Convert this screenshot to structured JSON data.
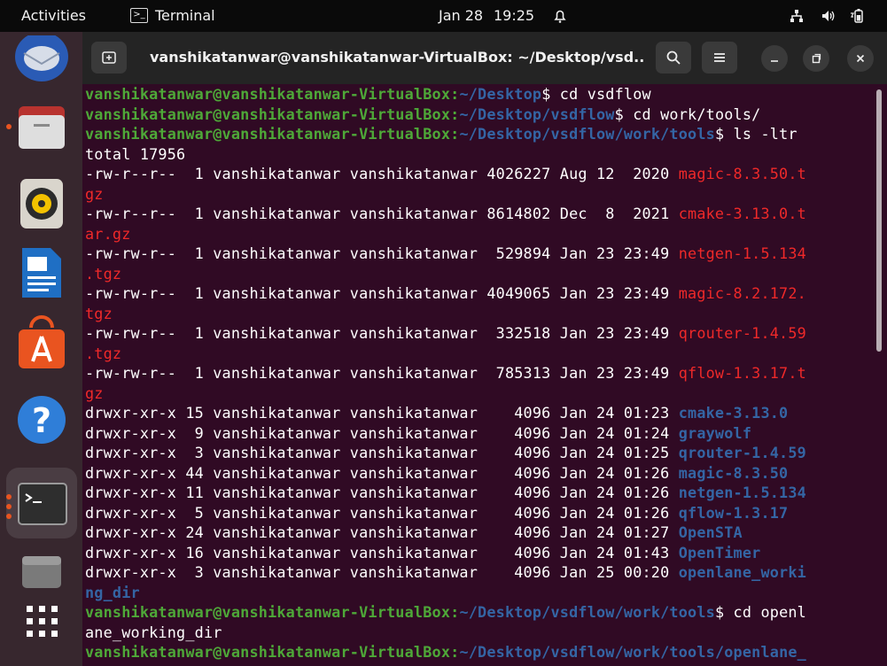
{
  "topbar": {
    "activities": "Activities",
    "app_name": "Terminal",
    "date": "Jan 28",
    "time": "19:25"
  },
  "window": {
    "title": "vanshikatanwar@vanshikatanwar-VirtualBox: ~/Desktop/vsd..."
  },
  "terminal": {
    "lines": [
      {
        "kind": "prompt",
        "user": "vanshikatanwar@vanshikatanwar-VirtualBox",
        "path": "~/Desktop",
        "cmd": "$ cd vsdflow"
      },
      {
        "kind": "prompt",
        "user": "vanshikatanwar@vanshikatanwar-VirtualBox",
        "path": "~/Desktop/vsdflow",
        "cmd": "$ cd work/tools/"
      },
      {
        "kind": "prompt",
        "user": "vanshikatanwar@vanshikatanwar-VirtualBox",
        "path": "~/Desktop/vsdflow/work/tools",
        "cmd": "$ ls -ltr"
      },
      {
        "kind": "text",
        "text": "total 17956"
      },
      {
        "kind": "entry",
        "meta": "-rw-r--r--  1 vanshikatanwar vanshikatanwar 4026227 Aug 12  2020 ",
        "name": "magic-8.3.50.t",
        "type": "arc"
      },
      {
        "kind": "cont",
        "name": "gz",
        "type": "arc"
      },
      {
        "kind": "entry",
        "meta": "-rw-r--r--  1 vanshikatanwar vanshikatanwar 8614802 Dec  8  2021 ",
        "name": "cmake-3.13.0.t",
        "type": "arc"
      },
      {
        "kind": "cont",
        "name": "ar.gz",
        "type": "arc"
      },
      {
        "kind": "entry",
        "meta": "-rw-rw-r--  1 vanshikatanwar vanshikatanwar  529894 Jan 23 23:49 ",
        "name": "netgen-1.5.134",
        "type": "arc"
      },
      {
        "kind": "cont",
        "name": ".tgz",
        "type": "arc"
      },
      {
        "kind": "entry",
        "meta": "-rw-rw-r--  1 vanshikatanwar vanshikatanwar 4049065 Jan 23 23:49 ",
        "name": "magic-8.2.172.",
        "type": "arc"
      },
      {
        "kind": "cont",
        "name": "tgz",
        "type": "arc"
      },
      {
        "kind": "entry",
        "meta": "-rw-rw-r--  1 vanshikatanwar vanshikatanwar  332518 Jan 23 23:49 ",
        "name": "qrouter-1.4.59",
        "type": "arc"
      },
      {
        "kind": "cont",
        "name": ".tgz",
        "type": "arc"
      },
      {
        "kind": "entry",
        "meta": "-rw-rw-r--  1 vanshikatanwar vanshikatanwar  785313 Jan 23 23:49 ",
        "name": "qflow-1.3.17.t",
        "type": "arc"
      },
      {
        "kind": "cont",
        "name": "gz",
        "type": "arc"
      },
      {
        "kind": "entry",
        "meta": "drwxr-xr-x 15 vanshikatanwar vanshikatanwar    4096 Jan 24 01:23 ",
        "name": "cmake-3.13.0",
        "type": "dir"
      },
      {
        "kind": "entry",
        "meta": "drwxr-xr-x  9 vanshikatanwar vanshikatanwar    4096 Jan 24 01:24 ",
        "name": "graywolf",
        "type": "dir"
      },
      {
        "kind": "entry",
        "meta": "drwxr-xr-x  3 vanshikatanwar vanshikatanwar    4096 Jan 24 01:25 ",
        "name": "qrouter-1.4.59",
        "type": "dir"
      },
      {
        "kind": "entry",
        "meta": "drwxr-xr-x 44 vanshikatanwar vanshikatanwar    4096 Jan 24 01:26 ",
        "name": "magic-8.3.50",
        "type": "dir"
      },
      {
        "kind": "entry",
        "meta": "drwxr-xr-x 11 vanshikatanwar vanshikatanwar    4096 Jan 24 01:26 ",
        "name": "netgen-1.5.134",
        "type": "dir"
      },
      {
        "kind": "entry",
        "meta": "drwxr-xr-x  5 vanshikatanwar vanshikatanwar    4096 Jan 24 01:26 ",
        "name": "qflow-1.3.17",
        "type": "dir"
      },
      {
        "kind": "entry",
        "meta": "drwxr-xr-x 24 vanshikatanwar vanshikatanwar    4096 Jan 24 01:27 ",
        "name": "OpenSTA",
        "type": "dir"
      },
      {
        "kind": "entry",
        "meta": "drwxr-xr-x 16 vanshikatanwar vanshikatanwar    4096 Jan 24 01:43 ",
        "name": "OpenTimer",
        "type": "dir"
      },
      {
        "kind": "entry",
        "meta": "drwxr-xr-x  3 vanshikatanwar vanshikatanwar    4096 Jan 25 00:20 ",
        "name": "openlane_worki",
        "type": "dir"
      },
      {
        "kind": "cont",
        "name": "ng_dir",
        "type": "dir"
      },
      {
        "kind": "prompt",
        "user": "vanshikatanwar@vanshikatanwar-VirtualBox",
        "path": "~/Desktop/vsdflow/work/tools",
        "cmd": "$ cd openl"
      },
      {
        "kind": "text",
        "text": "ane_working_dir"
      },
      {
        "kind": "prompt",
        "user": "vanshikatanwar@vanshikatanwar-VirtualBox",
        "path": "~/Desktop/vsdflow/work/tools/openlane_",
        "cmd": ""
      }
    ]
  },
  "colors": {
    "terminal_bg": "#300a24",
    "prompt_user": "#4ea838",
    "prompt_path": "#3465a4",
    "archive": "#ef2929",
    "directory": "#3465a4",
    "accent": "#e95420"
  },
  "icons": {
    "dock": [
      "thunderbird-icon",
      "files-icon",
      "rhythmbox-icon",
      "libreoffice-writer-icon",
      "app-center-icon",
      "help-icon",
      "terminal-icon",
      "trash-icon",
      "show-apps-icon"
    ],
    "tray": [
      "notification-bell-icon",
      "network-icon",
      "volume-icon",
      "battery-icon"
    ]
  }
}
